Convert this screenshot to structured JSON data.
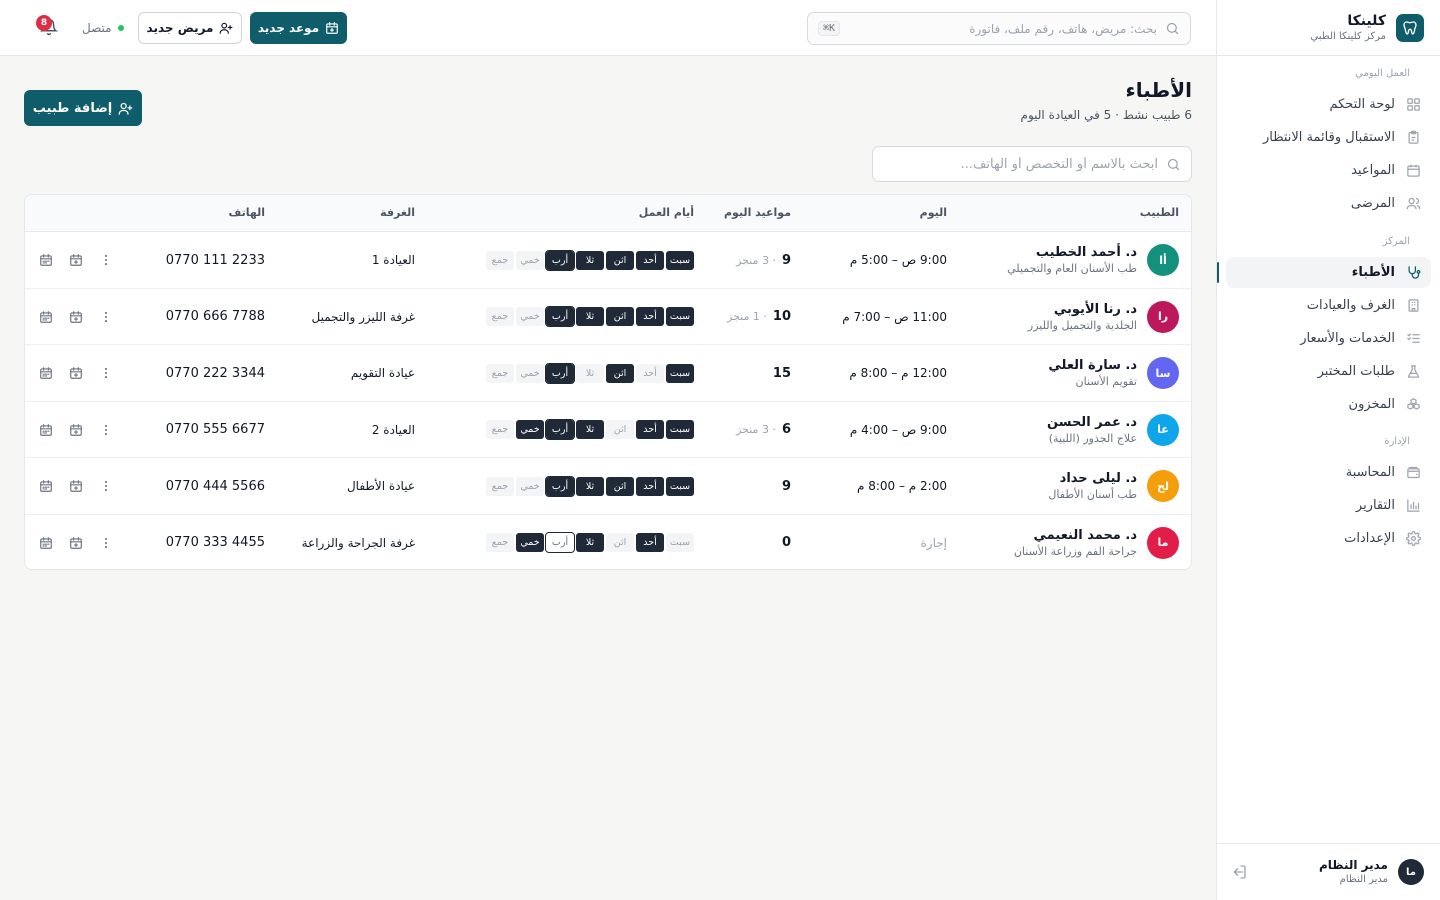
{
  "brand": {
    "name": "كلينكا",
    "subtitle": "مركز كلينكا الطبي"
  },
  "topbar": {
    "search_placeholder": "بحث: مريض، هاتف، رقم ملف، فاتورة",
    "search_shortcut": "⌘K",
    "new_appointment": "موعد جديد",
    "new_patient": "مريض جديد",
    "status": "متصل",
    "notifications_count": "8"
  },
  "sidebar": {
    "groups": [
      {
        "title": "العمل اليومي",
        "items": [
          {
            "label": "لوحة التحكم",
            "icon": "dashboard-icon"
          },
          {
            "label": "الاستقبال وقائمة الانتظار",
            "icon": "clipboard-icon"
          },
          {
            "label": "المواعيد",
            "icon": "calendar-icon"
          },
          {
            "label": "المرضى",
            "icon": "users-icon"
          }
        ]
      },
      {
        "title": "المركز",
        "items": [
          {
            "label": "الأطباء",
            "icon": "stethoscope-icon",
            "active": true
          },
          {
            "label": "الغرف والعيادات",
            "icon": "building-icon"
          },
          {
            "label": "الخدمات والأسعار",
            "icon": "list-check-icon"
          },
          {
            "label": "طلبات المختبر",
            "icon": "flask-icon"
          },
          {
            "label": "المخزون",
            "icon": "boxes-icon"
          }
        ]
      },
      {
        "title": "الإدارة",
        "items": [
          {
            "label": "المحاسبة",
            "icon": "wallet-icon"
          },
          {
            "label": "التقارير",
            "icon": "chart-icon"
          },
          {
            "label": "الإعدادات",
            "icon": "gear-icon"
          }
        ]
      }
    ]
  },
  "user": {
    "initials": "ما",
    "name": "مدير النظام",
    "role": "مدير النظام"
  },
  "page": {
    "title": "الأطباء",
    "subtitle": "6 طبيب نشط · 5 في العيادة اليوم",
    "add_button": "إضافة طبيب",
    "search_placeholder": "ابحث بالاسم أو التخصص أو الهاتف..."
  },
  "table": {
    "headers": {
      "doctor": "الطبيب",
      "today": "اليوم",
      "appointments": "مواعيد اليوم",
      "workdays": "أيام العمل",
      "room": "الغرفة",
      "phone": "الهاتف"
    },
    "day_labels": [
      "سبت",
      "أحد",
      "اثن",
      "ثلا",
      "أرب",
      "خمي",
      "جمع"
    ],
    "today_index": 4,
    "rows": [
      {
        "initials": "أا",
        "color": "#14917d",
        "name": "د. أحمد الخطيب",
        "specialty": "طب الأسنان العام والتجميلي",
        "hours": "9:00 ص – 5:00 م",
        "appt": "9",
        "done": "· 3 منجز",
        "days": [
          1,
          1,
          1,
          1,
          1,
          0,
          0
        ],
        "room": "العيادة 1",
        "phone": "0770 111 2233"
      },
      {
        "initials": "را",
        "color": "#be185d",
        "name": "د. رنا الأيوبي",
        "specialty": "الجلدية والتجميل والليزر",
        "hours": "11:00 ص – 7:00 م",
        "appt": "10",
        "done": "· 1 منجز",
        "days": [
          1,
          1,
          1,
          1,
          1,
          0,
          0
        ],
        "room": "غرفة الليزر والتجميل",
        "phone": "0770 666 7788"
      },
      {
        "initials": "سا",
        "color": "#6366f1",
        "name": "د. سارة العلي",
        "specialty": "تقويم الأسنان",
        "hours": "12:00 م – 8:00 م",
        "appt": "15",
        "done": "",
        "days": [
          1,
          0,
          1,
          0,
          1,
          0,
          0
        ],
        "room": "عيادة التقويم",
        "phone": "0770 222 3344"
      },
      {
        "initials": "عا",
        "color": "#0ea5e9",
        "name": "د. عمر الحسن",
        "specialty": "علاج الجذور (اللبية)",
        "hours": "9:00 ص – 4:00 م",
        "appt": "6",
        "done": "· 3 منجز",
        "days": [
          1,
          1,
          0,
          1,
          1,
          1,
          0
        ],
        "room": "العيادة 2",
        "phone": "0770 555 6677"
      },
      {
        "initials": "لح",
        "color": "#f59e0b",
        "name": "د. ليلى حداد",
        "specialty": "طب أسنان الأطفال",
        "hours": "2:00 م – 8:00 م",
        "appt": "9",
        "done": "",
        "days": [
          1,
          1,
          1,
          1,
          1,
          0,
          0
        ],
        "room": "عيادة الأطفال",
        "phone": "0770 444 5566"
      },
      {
        "initials": "ما",
        "color": "#e11d48",
        "name": "د. محمد النعيمي",
        "specialty": "جراحة الفم وزراعة الأسنان",
        "hours": "إجازة",
        "leave": true,
        "appt": "0",
        "done": "",
        "days": [
          0,
          1,
          0,
          1,
          0,
          1,
          0
        ],
        "room": "غرفة الجراحة والزراعة",
        "phone": "0770 333 4455"
      }
    ]
  },
  "colors": {
    "accent": "#0f5c6a",
    "online": "#22c55e",
    "badge": "#dc2f45"
  }
}
